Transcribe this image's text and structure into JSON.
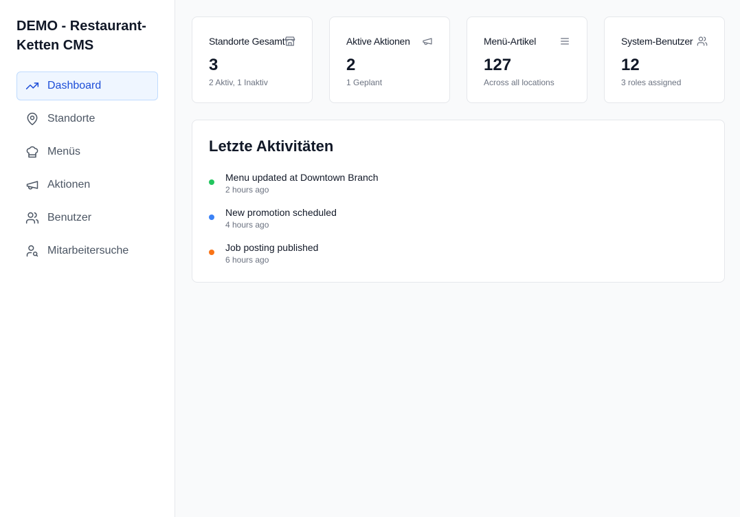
{
  "sidebar": {
    "brand": "DEMO - Restaurant-Ketten CMS",
    "items": [
      {
        "label": "Dashboard",
        "icon": "trending-up-icon",
        "active": true
      },
      {
        "label": "Standorte",
        "icon": "map-pin-icon"
      },
      {
        "label": "Menüs",
        "icon": "chef-hat-icon"
      },
      {
        "label": "Aktionen",
        "icon": "megaphone-icon"
      },
      {
        "label": "Benutzer",
        "icon": "users-icon"
      },
      {
        "label": "Mitarbeitersuche",
        "icon": "user-search-icon"
      }
    ]
  },
  "stats": [
    {
      "title": "Standorte Gesamt",
      "icon": "store-icon",
      "value": "3",
      "sub": "2 Aktiv, 1 Inaktiv"
    },
    {
      "title": "Aktive Aktionen",
      "icon": "megaphone-icon",
      "value": "2",
      "sub": "1 Geplant"
    },
    {
      "title": "Menü-Artikel",
      "icon": "menu-lines-icon",
      "value": "127",
      "sub": "Across all locations"
    },
    {
      "title": "System-Benutzer",
      "icon": "users-icon",
      "value": "12",
      "sub": "3 roles assigned"
    }
  ],
  "activity": {
    "title": "Letzte Aktivitäten",
    "items": [
      {
        "text": "Menu updated at Downtown Branch",
        "time": "2 hours ago",
        "color": "#22c55e"
      },
      {
        "text": "New promotion scheduled",
        "time": "4 hours ago",
        "color": "#3b82f6"
      },
      {
        "text": "Job posting published",
        "time": "6 hours ago",
        "color": "#f97316"
      }
    ]
  },
  "colors": {
    "accent": "#1d4ed8",
    "active_bg": "#eff6ff"
  }
}
